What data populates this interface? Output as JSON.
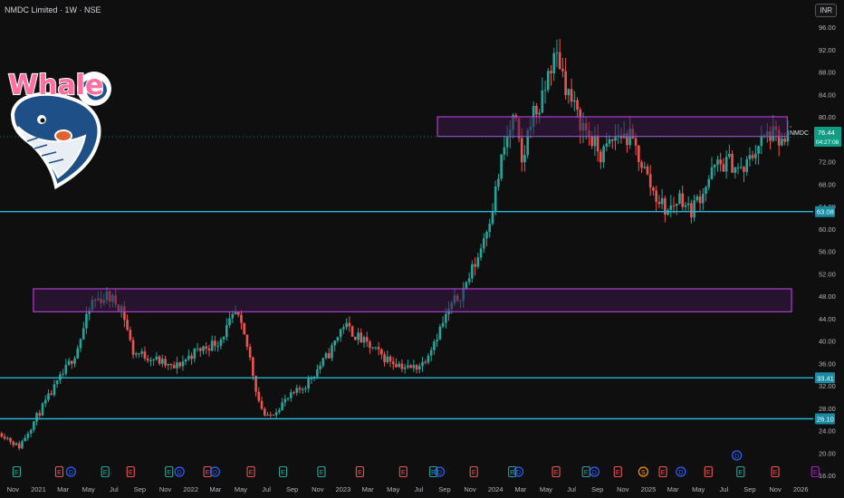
{
  "header": {
    "title": "NMDC Limited · 1W · NSE",
    "currency": "INR"
  },
  "logo": {
    "text": "Whale"
  },
  "colors": {
    "background": "#0f0f0f",
    "up": "#26a69a",
    "down": "#ef5350",
    "zone_fill": "#3a1a4a",
    "zone_stroke": "#b13bd0",
    "level_line": "#22b8d6",
    "price_badge": "#0f9d84"
  },
  "price_badge": {
    "symbol": "NMDC",
    "price": "76.44",
    "countdown": "04:27:08"
  },
  "chart_data": {
    "type": "candlestick",
    "ylim": [
      16,
      96
    ],
    "xlim": [
      "2020-10-01",
      "2026-01-31"
    ],
    "y_ticks": [
      "96.00",
      "92.00",
      "88.00",
      "84.00",
      "80.00",
      "76.00",
      "72.00",
      "68.00",
      "64.00",
      "60.00",
      "56.00",
      "52.00",
      "48.00",
      "44.00",
      "40.00",
      "36.00",
      "32.00",
      "28.00",
      "24.00",
      "20.00",
      "16.00"
    ],
    "x_ticks": [
      {
        "label": "Nov",
        "date": "2020-11-01"
      },
      {
        "label": "2021",
        "date": "2021-01-01"
      },
      {
        "label": "Mar",
        "date": "2021-03-01"
      },
      {
        "label": "May",
        "date": "2021-05-01"
      },
      {
        "label": "Jul",
        "date": "2021-07-01"
      },
      {
        "label": "Sep",
        "date": "2021-09-01"
      },
      {
        "label": "Nov",
        "date": "2021-11-01"
      },
      {
        "label": "2022",
        "date": "2022-01-01"
      },
      {
        "label": "Mar",
        "date": "2022-03-01"
      },
      {
        "label": "May",
        "date": "2022-05-01"
      },
      {
        "label": "Jul",
        "date": "2022-07-01"
      },
      {
        "label": "Sep",
        "date": "2022-09-01"
      },
      {
        "label": "Nov",
        "date": "2022-11-01"
      },
      {
        "label": "2023",
        "date": "2023-01-01"
      },
      {
        "label": "Mar",
        "date": "2023-03-01"
      },
      {
        "label": "May",
        "date": "2023-05-01"
      },
      {
        "label": "Jul",
        "date": "2023-07-01"
      },
      {
        "label": "Sep",
        "date": "2023-09-01"
      },
      {
        "label": "Nov",
        "date": "2023-11-01"
      },
      {
        "label": "2024",
        "date": "2024-01-01"
      },
      {
        "label": "Mar",
        "date": "2024-03-01"
      },
      {
        "label": "May",
        "date": "2024-05-01"
      },
      {
        "label": "Jul",
        "date": "2024-07-01"
      },
      {
        "label": "Sep",
        "date": "2024-09-01"
      },
      {
        "label": "Nov",
        "date": "2024-11-01"
      },
      {
        "label": "2025",
        "date": "2025-01-01"
      },
      {
        "label": "Mar",
        "date": "2025-03-01"
      },
      {
        "label": "May",
        "date": "2025-05-01"
      },
      {
        "label": "Jul",
        "date": "2025-07-01"
      },
      {
        "label": "Sep",
        "date": "2025-09-01"
      },
      {
        "label": "Nov",
        "date": "2025-11-01"
      },
      {
        "label": "2026",
        "date": "2026-01-01"
      }
    ],
    "horizontal_levels": [
      {
        "value": 63.08,
        "label": "63.08"
      },
      {
        "value": 33.41,
        "label": "33.41"
      },
      {
        "value": 26.1,
        "label": "26.10"
      }
    ],
    "zones": [
      {
        "name": "upper-zone",
        "start": "2023-08-15",
        "end": "2025-11-30",
        "low": 76.5,
        "high": 80.0
      },
      {
        "name": "lower-zone",
        "start": "2020-12-20",
        "end": "2025-12-10",
        "low": 45.2,
        "high": 49.3
      }
    ],
    "anchors": [
      {
        "date": "2020-10-05",
        "close": 23.5
      },
      {
        "date": "2020-11-15",
        "close": 21
      },
      {
        "date": "2021-01-01",
        "close": 27
      },
      {
        "date": "2021-02-20",
        "close": 33
      },
      {
        "date": "2021-04-01",
        "close": 38
      },
      {
        "date": "2021-05-10",
        "close": 47
      },
      {
        "date": "2021-06-15",
        "close": 48
      },
      {
        "date": "2021-07-20",
        "close": 46
      },
      {
        "date": "2021-08-15",
        "close": 38
      },
      {
        "date": "2021-10-01",
        "close": 37
      },
      {
        "date": "2021-11-20",
        "close": 35
      },
      {
        "date": "2022-01-10",
        "close": 38
      },
      {
        "date": "2022-03-10",
        "close": 40
      },
      {
        "date": "2022-04-20",
        "close": 45
      },
      {
        "date": "2022-05-20",
        "close": 38
      },
      {
        "date": "2022-06-10",
        "close": 30
      },
      {
        "date": "2022-07-01",
        "close": 26
      },
      {
        "date": "2022-08-10",
        "close": 29
      },
      {
        "date": "2022-10-01",
        "close": 32
      },
      {
        "date": "2022-12-01",
        "close": 38
      },
      {
        "date": "2023-01-01",
        "close": 43
      },
      {
        "date": "2023-02-15",
        "close": 40
      },
      {
        "date": "2023-04-10",
        "close": 37
      },
      {
        "date": "2023-06-10",
        "close": 35
      },
      {
        "date": "2023-07-10",
        "close": 36
      },
      {
        "date": "2023-08-20",
        "close": 42
      },
      {
        "date": "2023-09-15",
        "close": 46
      },
      {
        "date": "2023-10-15",
        "close": 49
      },
      {
        "date": "2023-11-20",
        "close": 55
      },
      {
        "date": "2023-12-25",
        "close": 64
      },
      {
        "date": "2024-01-20",
        "close": 74
      },
      {
        "date": "2024-02-15",
        "close": 80
      },
      {
        "date": "2024-03-05",
        "close": 71
      },
      {
        "date": "2024-03-25",
        "close": 80
      },
      {
        "date": "2024-04-20",
        "close": 82
      },
      {
        "date": "2024-05-10",
        "close": 89
      },
      {
        "date": "2024-05-30",
        "close": 91
      },
      {
        "date": "2024-06-20",
        "close": 85
      },
      {
        "date": "2024-07-15",
        "close": 80
      },
      {
        "date": "2024-08-10",
        "close": 77
      },
      {
        "date": "2024-09-10",
        "close": 73
      },
      {
        "date": "2024-10-20",
        "close": 77
      },
      {
        "date": "2024-11-20",
        "close": 76
      },
      {
        "date": "2024-12-15",
        "close": 72
      },
      {
        "date": "2025-01-10",
        "close": 67
      },
      {
        "date": "2025-02-15",
        "close": 63
      },
      {
        "date": "2025-03-20",
        "close": 66
      },
      {
        "date": "2025-04-10",
        "close": 63
      },
      {
        "date": "2025-05-05",
        "close": 66
      },
      {
        "date": "2025-06-10",
        "close": 71
      },
      {
        "date": "2025-07-15",
        "close": 72
      },
      {
        "date": "2025-08-15",
        "close": 70
      },
      {
        "date": "2025-09-20",
        "close": 75
      },
      {
        "date": "2025-10-20",
        "close": 77
      },
      {
        "date": "2025-11-20",
        "close": 75
      },
      {
        "date": "2025-12-08",
        "close": 76.44
      }
    ],
    "events": [
      {
        "label": "E",
        "type": "earnings",
        "date": "2020-11-10"
      },
      {
        "label": "E",
        "type": "earnings-down",
        "date": "2021-02-20"
      },
      {
        "label": "D",
        "type": "dividend",
        "date": "2021-03-20"
      },
      {
        "label": "E",
        "type": "earnings",
        "date": "2021-06-10"
      },
      {
        "label": "E",
        "type": "earnings-down",
        "date": "2021-08-10"
      },
      {
        "label": "E",
        "type": "earnings",
        "date": "2021-11-10"
      },
      {
        "label": "D",
        "type": "dividend",
        "date": "2021-12-05"
      },
      {
        "label": "E",
        "type": "earnings-down",
        "date": "2022-02-10"
      },
      {
        "label": "D",
        "type": "dividend",
        "date": "2022-02-28"
      },
      {
        "label": "E",
        "type": "earnings-down",
        "date": "2022-05-25"
      },
      {
        "label": "E",
        "type": "earnings",
        "date": "2022-08-10"
      },
      {
        "label": "E",
        "type": "earnings",
        "date": "2022-11-10"
      },
      {
        "label": "E",
        "type": "earnings-down",
        "date": "2023-02-10"
      },
      {
        "label": "E",
        "type": "earnings-down",
        "date": "2023-05-25"
      },
      {
        "label": "E",
        "type": "earnings",
        "date": "2023-08-05"
      },
      {
        "label": "D",
        "type": "dividend",
        "date": "2023-08-20"
      },
      {
        "label": "E",
        "type": "earnings-down",
        "date": "2023-11-10"
      },
      {
        "label": "E",
        "type": "earnings",
        "date": "2024-02-10"
      },
      {
        "label": "D",
        "type": "dividend",
        "date": "2024-02-25"
      },
      {
        "label": "E",
        "type": "earnings-down",
        "date": "2024-05-25"
      },
      {
        "label": "E",
        "type": "earnings",
        "date": "2024-08-05"
      },
      {
        "label": "D",
        "type": "dividend",
        "date": "2024-08-25"
      },
      {
        "label": "E",
        "type": "earnings-down",
        "date": "2024-10-20"
      },
      {
        "label": "S",
        "type": "split",
        "date": "2024-12-20"
      },
      {
        "label": "E",
        "type": "earnings-down",
        "date": "2025-02-05"
      },
      {
        "label": "D",
        "type": "dividend",
        "date": "2025-03-20"
      },
      {
        "label": "E",
        "type": "earnings-down",
        "date": "2025-05-25"
      },
      {
        "label": "D",
        "type": "dividend",
        "date": "2025-08-01",
        "row": 2
      },
      {
        "label": "E",
        "type": "earnings",
        "date": "2025-08-10"
      },
      {
        "label": "E",
        "type": "earnings-down",
        "date": "2025-11-01"
      },
      {
        "label": "E",
        "type": "upcoming",
        "date": "2026-02-05"
      }
    ]
  }
}
